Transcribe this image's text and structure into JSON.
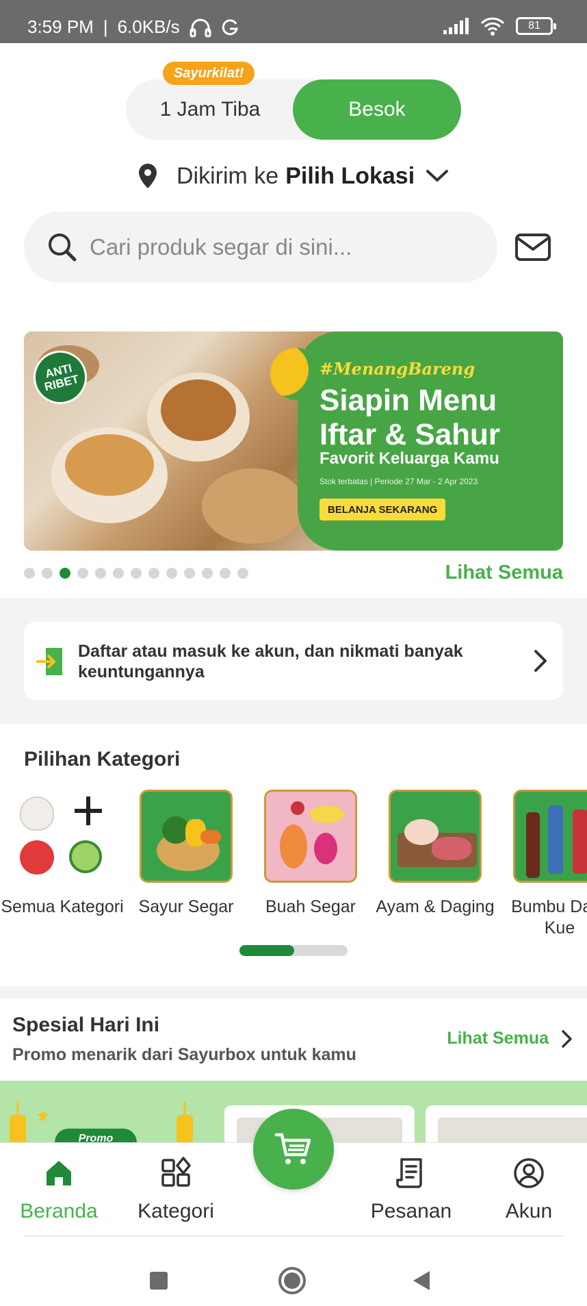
{
  "status_bar": {
    "time": "3:59 PM",
    "separator": "|",
    "net_speed": "6.0KB/s",
    "battery": "81"
  },
  "delivery": {
    "badge": "Sayurkilat!",
    "option_fast": "1 Jam Tiba",
    "option_tomorrow": "Besok",
    "selected": "Besok"
  },
  "location": {
    "prefix": "Dikirim ke",
    "value": "Pilih Lokasi"
  },
  "search": {
    "placeholder": "Cari produk segar di sini..."
  },
  "banner": {
    "hashtag": "#MenangBareng",
    "headline": "Siapin Menu Iftar & Sahur",
    "subheadline": "Favorit Keluarga Kamu",
    "note": "Stok terbatas | Periode 27 Mar - 2 Apr 2023",
    "cta": "BELANJA SEKARANG",
    "sticker": "ANTI RIBET",
    "dot_count": 13,
    "active_dot": 2,
    "see_all": "Lihat Semua"
  },
  "login_prompt": {
    "text": "Daftar atau masuk ke akun, dan nikmati banyak keuntungannya"
  },
  "categories": {
    "title": "Pilihan Kategori",
    "items": [
      {
        "label": "Semua Kategori"
      },
      {
        "label": "Sayur Segar"
      },
      {
        "label": "Buah Segar"
      },
      {
        "label": "Ayam & Daging"
      },
      {
        "label": "Bumbu Da & Kue"
      }
    ],
    "scroll_position": 0.5
  },
  "special": {
    "title": "Spesial Hari Ini",
    "subtitle": "Promo menarik dari Sayurbox untuk kamu",
    "see_all": "Lihat Semua",
    "promo_tag": "Promo"
  },
  "bottom_nav": {
    "items": [
      {
        "label": "Beranda",
        "icon": "home-icon",
        "active": true
      },
      {
        "label": "Kategori",
        "icon": "category-grid-icon",
        "active": false
      },
      {
        "label": "Pesanan",
        "icon": "receipt-icon",
        "active": false
      },
      {
        "label": "Akun",
        "icon": "account-icon",
        "active": false
      }
    ]
  },
  "colors": {
    "brand_green": "#48b14b",
    "dark_green": "#1e8a3a",
    "badge_orange": "#f6a31a",
    "banner_green": "#48a545",
    "banner_yellow": "#f9dc3b"
  }
}
